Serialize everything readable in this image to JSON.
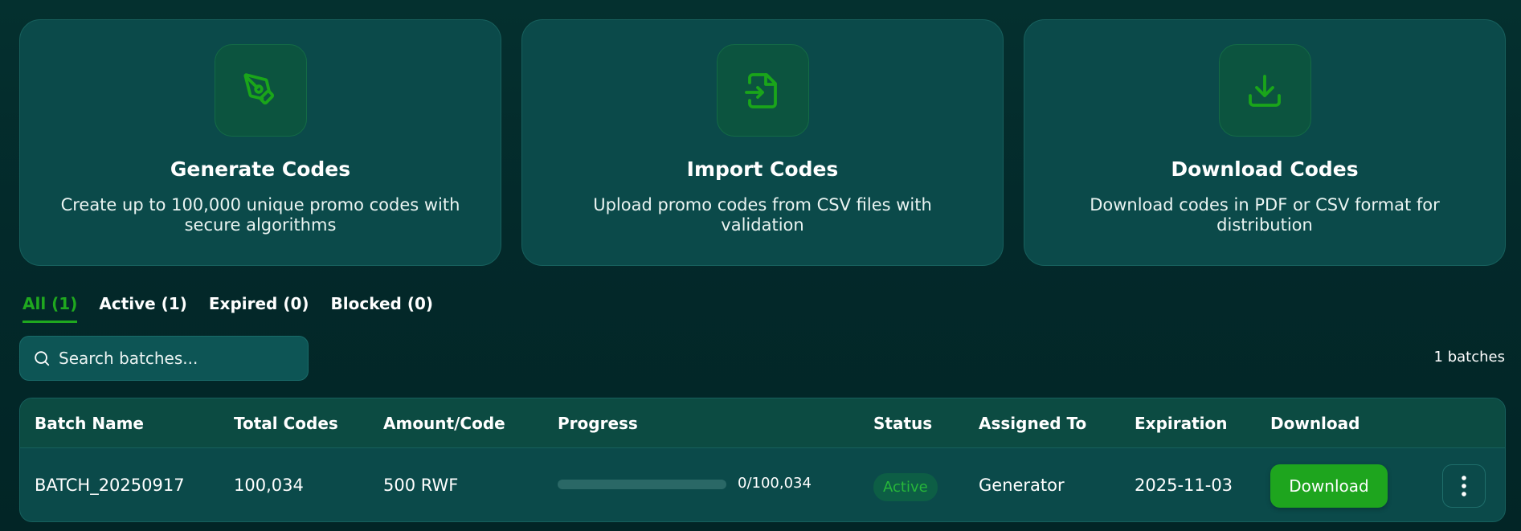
{
  "cards": [
    {
      "title": "Generate Codes",
      "description": "Create up to 100,000 unique promo codes with secure algorithms",
      "icon": "pen-tool-icon"
    },
    {
      "title": "Import Codes",
      "description": "Upload promo codes from CSV files with validation",
      "icon": "file-import-icon"
    },
    {
      "title": "Download Codes",
      "description": "Download codes in PDF or CSV format for distribution",
      "icon": "download-icon"
    }
  ],
  "tabs": [
    {
      "label": "All (1)",
      "active": true
    },
    {
      "label": "Active (1)",
      "active": false
    },
    {
      "label": "Expired (0)",
      "active": false
    },
    {
      "label": "Blocked (0)",
      "active": false
    }
  ],
  "search": {
    "placeholder": "Search batches...",
    "value": ""
  },
  "batch_count": "1 batches",
  "table": {
    "headers": [
      "Batch Name",
      "Total Codes",
      "Amount/Code",
      "Progress",
      "Status",
      "Assigned To",
      "Expiration",
      "Download"
    ],
    "rows": [
      {
        "batch_name": "BATCH_20250917",
        "total_codes": "100,034",
        "amount_per_code": "500 RWF",
        "progress_text": "0/100,034",
        "progress_fraction": 0,
        "status": "Active",
        "assigned_to": "Generator",
        "expiration": "2025-11-03",
        "download_label": "Download"
      }
    ]
  },
  "colors": {
    "background": "#04302f",
    "card": "#0b4a4a",
    "accent_green": "#1ea51e",
    "icon_green": "#1aa51a"
  }
}
